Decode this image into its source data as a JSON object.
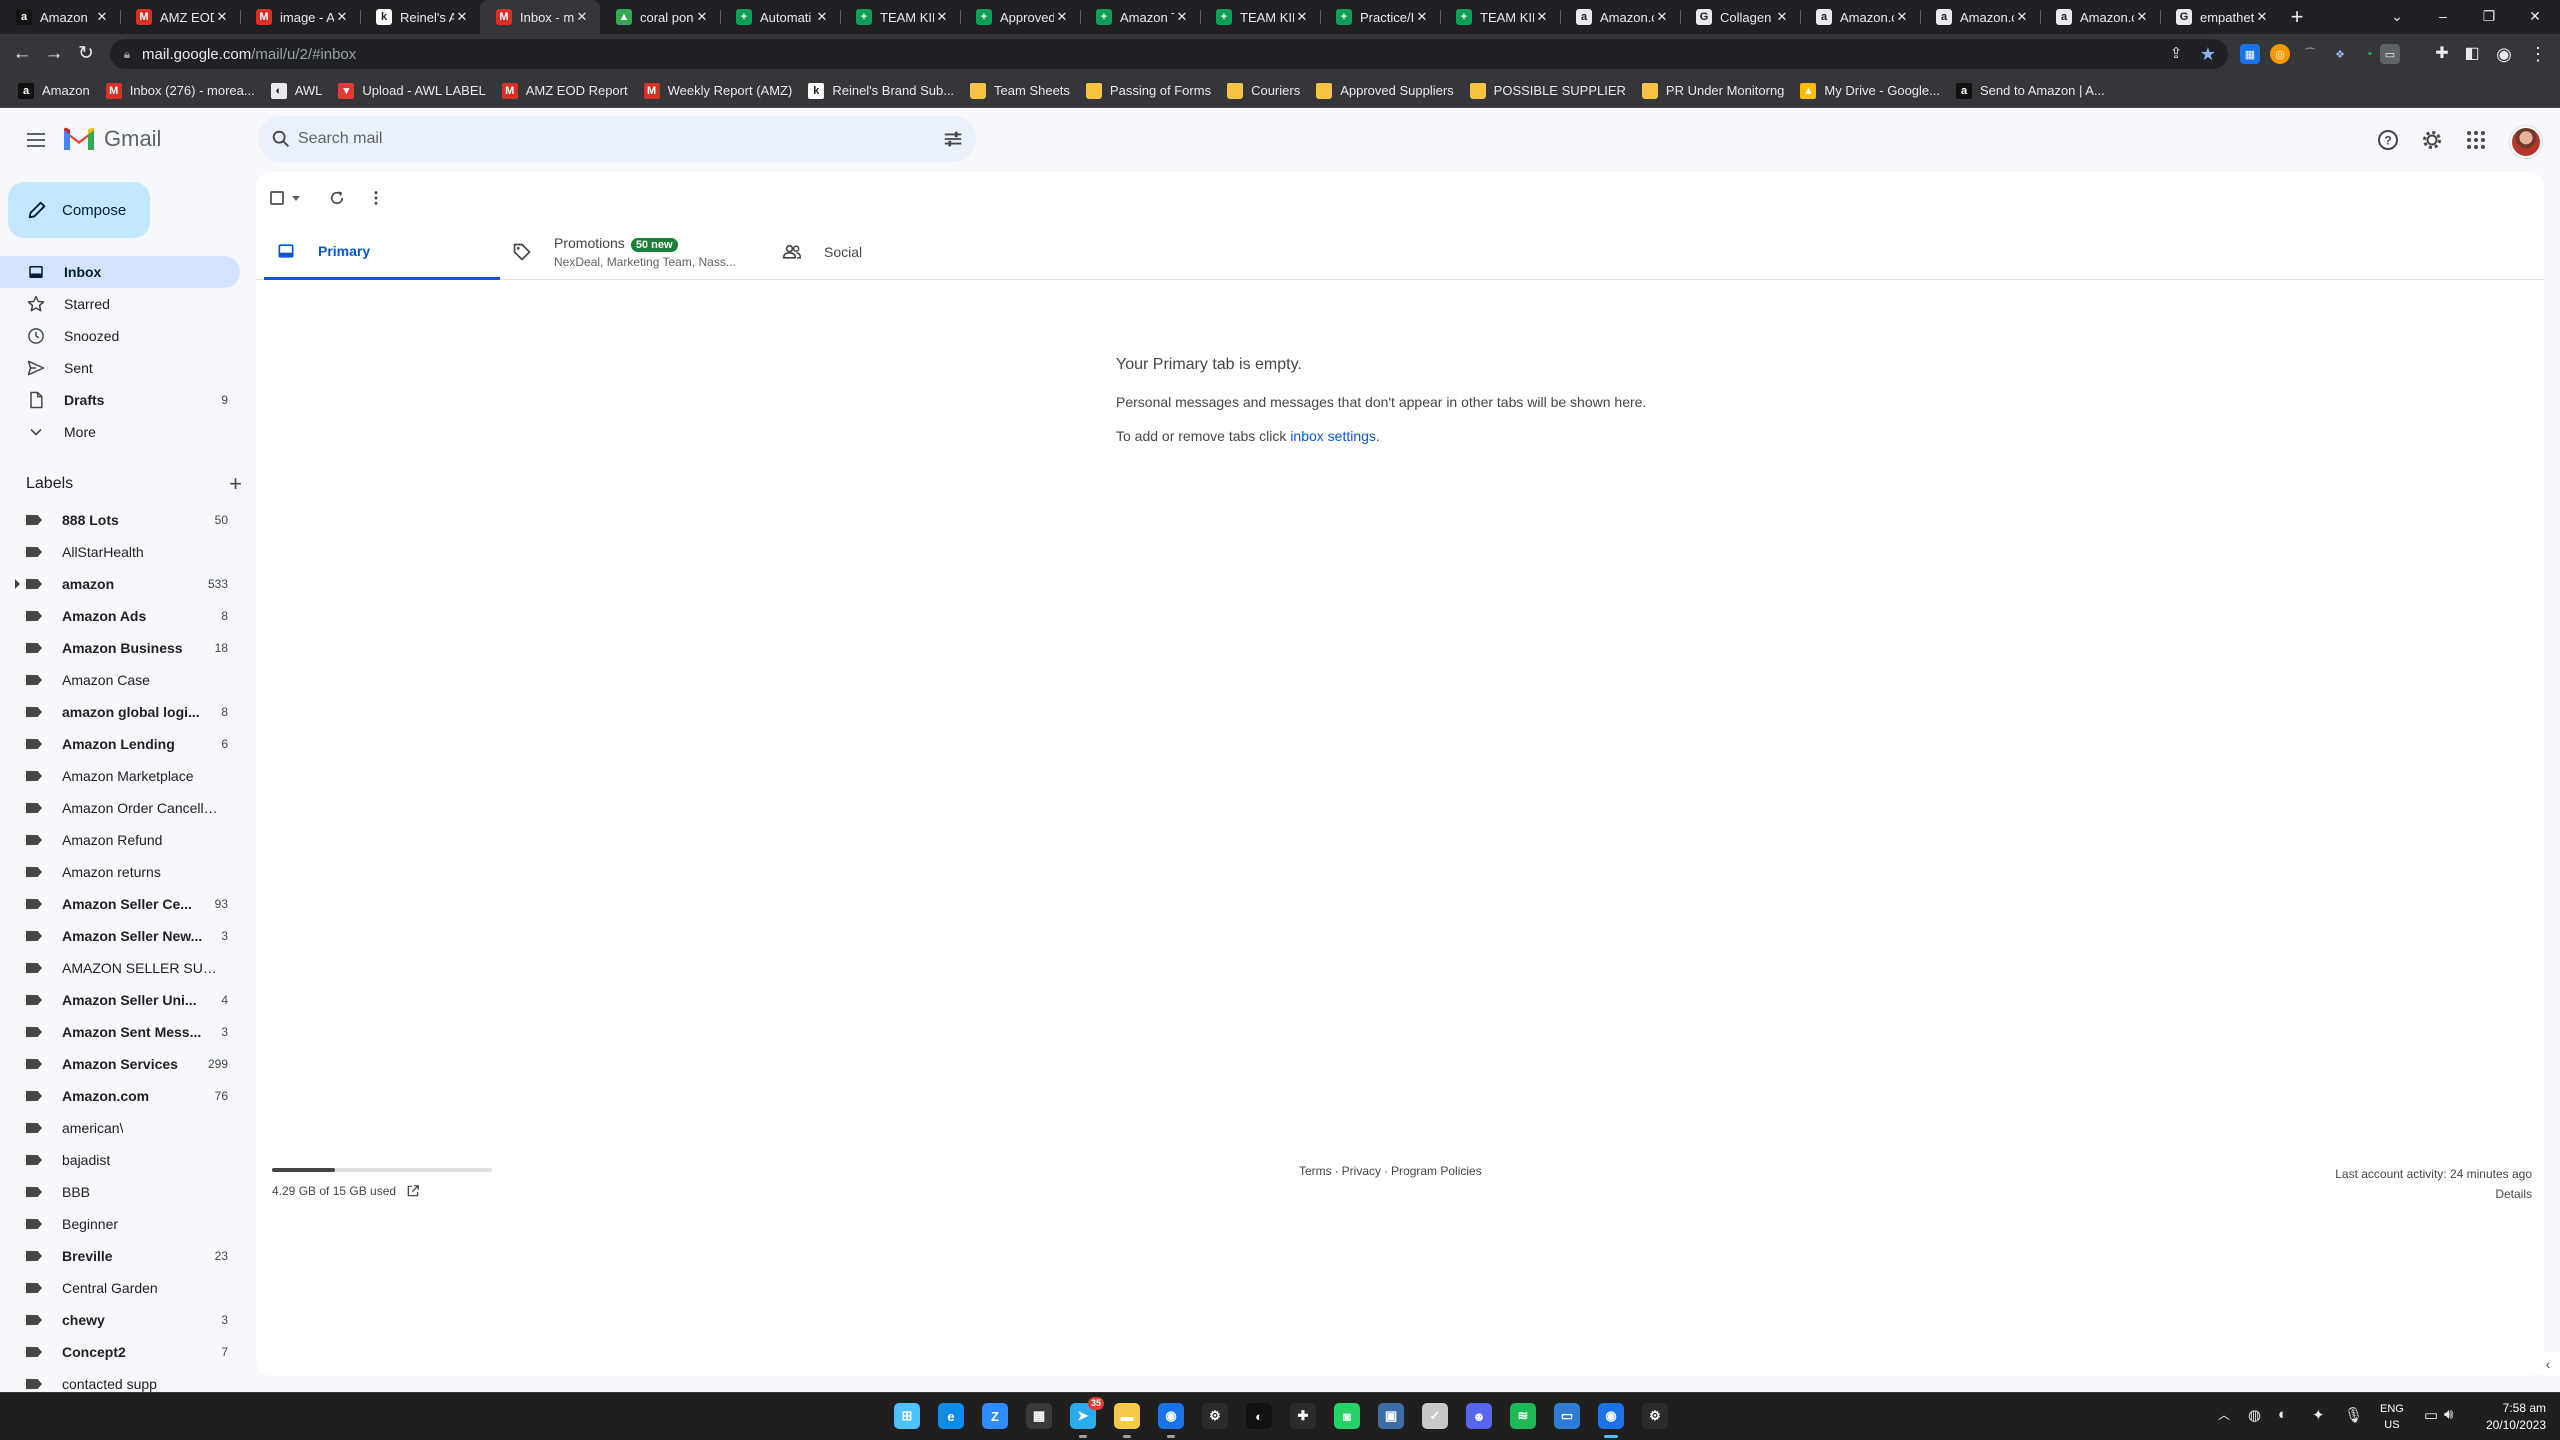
{
  "browser": {
    "tabs": [
      {
        "title": "Amazon",
        "icon": "amazon-icon",
        "color": "#111111",
        "glyph": "a"
      },
      {
        "title": "AMZ EOD",
        "icon": "gmail-icon",
        "color": "#d93025",
        "glyph": "M"
      },
      {
        "title": "image - A",
        "icon": "gmail-icon",
        "color": "#d93025",
        "glyph": "M"
      },
      {
        "title": "Reinel's A",
        "icon": "app-icon",
        "color": "#ffffff",
        "glyph": "k"
      },
      {
        "title": "Inbox - m",
        "icon": "gmail-icon",
        "color": "#d93025",
        "glyph": "M",
        "active": true
      },
      {
        "title": "coral pon",
        "icon": "drive-icon",
        "color": "#34a853",
        "glyph": "▲"
      },
      {
        "title": "Automati",
        "icon": "sheets-icon",
        "color": "#0f9d58",
        "glyph": "+"
      },
      {
        "title": "TEAM KIM",
        "icon": "sheets-icon",
        "color": "#0f9d58",
        "glyph": "+"
      },
      {
        "title": "Approved",
        "icon": "sheets-icon",
        "color": "#0f9d58",
        "glyph": "+"
      },
      {
        "title": "Amazon T",
        "icon": "sheets-icon",
        "color": "#0f9d58",
        "glyph": "+"
      },
      {
        "title": "TEAM KIM",
        "icon": "sheets-icon",
        "color": "#0f9d58",
        "glyph": "+"
      },
      {
        "title": "Practice/I",
        "icon": "sheets-icon",
        "color": "#0f9d58",
        "glyph": "+"
      },
      {
        "title": "TEAM KIM",
        "icon": "sheets-icon",
        "color": "#0f9d58",
        "glyph": "+"
      },
      {
        "title": "Amazon.c",
        "icon": "amazon-icon",
        "color": "#e8eaed",
        "glyph": "a"
      },
      {
        "title": "Collagen",
        "icon": "google-icon",
        "color": "#e8eaed",
        "glyph": "G"
      },
      {
        "title": "Amazon.c",
        "icon": "amazon-icon",
        "color": "#e8eaed",
        "glyph": "a"
      },
      {
        "title": "Amazon.c",
        "icon": "amazon-icon",
        "color": "#e8eaed",
        "glyph": "a"
      },
      {
        "title": "Amazon.c",
        "icon": "amazon-icon",
        "color": "#e8eaed",
        "glyph": "a"
      },
      {
        "title": "empathet",
        "icon": "google-icon",
        "color": "#e8eaed",
        "glyph": "G"
      }
    ],
    "url_host": "mail.google.com",
    "url_path": "/mail/u/2/#inbox",
    "bookmarks": [
      {
        "label": "Amazon",
        "icon": "amazon-icon",
        "kind": "site",
        "color": "#111111",
        "glyph": "a"
      },
      {
        "label": "Inbox (276) - morea...",
        "icon": "gmail-icon",
        "kind": "site",
        "color": "#d93025",
        "glyph": "M"
      },
      {
        "label": "AWL",
        "icon": "site-icon",
        "kind": "site",
        "color": "#e8eaed",
        "glyph": "◐"
      },
      {
        "label": "Upload - AWL LABEL",
        "icon": "site-icon",
        "kind": "site",
        "color": "#e53935",
        "glyph": "▾"
      },
      {
        "label": "AMZ EOD Report",
        "icon": "gmail-icon",
        "kind": "site",
        "color": "#d93025",
        "glyph": "M"
      },
      {
        "label": "Weekly Report (AMZ)",
        "icon": "gmail-icon",
        "kind": "site",
        "color": "#d93025",
        "glyph": "M"
      },
      {
        "label": "Reinel's Brand Sub...",
        "icon": "app-icon",
        "kind": "site",
        "color": "#ffffff",
        "glyph": "k"
      },
      {
        "label": "Team Sheets",
        "icon": "folder-icon",
        "kind": "folder"
      },
      {
        "label": "Passing of Forms",
        "icon": "folder-icon",
        "kind": "folder"
      },
      {
        "label": "Couriers",
        "icon": "folder-icon",
        "kind": "folder"
      },
      {
        "label": "Approved Suppliers",
        "icon": "folder-icon",
        "kind": "folder"
      },
      {
        "label": "POSSIBLE SUPPLIER",
        "icon": "folder-icon",
        "kind": "folder"
      },
      {
        "label": "PR Under Monitorng",
        "icon": "folder-icon",
        "kind": "folder"
      },
      {
        "label": "My Drive - Google...",
        "icon": "drive-icon",
        "kind": "site",
        "color": "#fbbc04",
        "glyph": "▲"
      },
      {
        "label": "Send to Amazon | A...",
        "icon": "amazon-icon",
        "kind": "site",
        "color": "#111111",
        "glyph": "a"
      }
    ]
  },
  "gmail": {
    "brand": "Gmail",
    "search_placeholder": "Search mail",
    "compose_label": "Compose",
    "nav": [
      {
        "label": "Inbox",
        "icon": "inbox-icon",
        "count": "",
        "active": true
      },
      {
        "label": "Starred",
        "icon": "star-icon",
        "count": ""
      },
      {
        "label": "Snoozed",
        "icon": "clock-icon",
        "count": ""
      },
      {
        "label": "Sent",
        "icon": "send-icon",
        "count": ""
      },
      {
        "label": "Drafts",
        "icon": "draft-icon",
        "count": "9",
        "bold": true
      },
      {
        "label": "More",
        "icon": "chevron-down-icon",
        "count": ""
      }
    ],
    "labels_title": "Labels",
    "labels": [
      {
        "name": "888 Lots",
        "count": "50",
        "bold": true
      },
      {
        "name": "AllStarHealth",
        "count": ""
      },
      {
        "name": "amazon",
        "count": "533",
        "bold": true,
        "expand": true
      },
      {
        "name": "Amazon Ads",
        "count": "8",
        "bold": true
      },
      {
        "name": "Amazon Business",
        "count": "18",
        "bold": true
      },
      {
        "name": "Amazon Case",
        "count": ""
      },
      {
        "name": "amazon global logi...",
        "count": "8",
        "bold": true
      },
      {
        "name": "Amazon Lending",
        "count": "6",
        "bold": true
      },
      {
        "name": "Amazon Marketplace",
        "count": ""
      },
      {
        "name": "Amazon Order Cancella...",
        "count": ""
      },
      {
        "name": "Amazon Refund",
        "count": ""
      },
      {
        "name": "Amazon returns",
        "count": ""
      },
      {
        "name": "Amazon Seller Ce...",
        "count": "93",
        "bold": true
      },
      {
        "name": "Amazon Seller New...",
        "count": "3",
        "bold": true
      },
      {
        "name": "AMAZON SELLER SUPP...",
        "count": ""
      },
      {
        "name": "Amazon Seller Uni...",
        "count": "4",
        "bold": true
      },
      {
        "name": "Amazon Sent Mess...",
        "count": "3",
        "bold": true
      },
      {
        "name": "Amazon Services",
        "count": "299",
        "bold": true
      },
      {
        "name": "Amazon.com",
        "count": "76",
        "bold": true
      },
      {
        "name": "american\\",
        "count": ""
      },
      {
        "name": "bajadist",
        "count": ""
      },
      {
        "name": "BBB",
        "count": ""
      },
      {
        "name": "Beginner",
        "count": ""
      },
      {
        "name": "Breville",
        "count": "23",
        "bold": true
      },
      {
        "name": "Central Garden",
        "count": ""
      },
      {
        "name": "chewy",
        "count": "3",
        "bold": true
      },
      {
        "name": "Concept2",
        "count": "7",
        "bold": true
      },
      {
        "name": "contacted supp",
        "count": ""
      }
    ],
    "inbox_tabs": [
      {
        "label": "Primary",
        "icon": "inbox-icon",
        "active": true
      },
      {
        "label": "Promotions",
        "icon": "tag-icon",
        "badge": "50 new",
        "subtitle": "NexDeal, Marketing Team, Nass..."
      },
      {
        "label": "Social",
        "icon": "people-icon"
      }
    ],
    "empty_title": "Your Primary tab is empty.",
    "empty_body": "Personal messages and messages that don't appear in other tabs will be shown here.",
    "empty_hint_prefix": "To add or remove tabs click ",
    "empty_hint_link": "inbox settings",
    "empty_hint_suffix": ".",
    "storage_text": "4.29 GB of 15 GB used",
    "storage_fraction": 0.286,
    "footer_terms": "Terms",
    "footer_privacy": "Privacy",
    "footer_policies": "Program Policies",
    "footer_sep": "·",
    "last_activity": "Last account activity: 24 minutes ago",
    "details_link": "Details"
  },
  "taskbar": {
    "apps": [
      "windows-start-icon",
      "edge-icon",
      "zoom-icon",
      "calculator-icon",
      "telegram-icon",
      "file-explorer-icon",
      "chrome-icon",
      "settings-icon",
      "app-icon",
      "xbox-icon",
      "whatsapp-icon",
      "virtualbox-icon",
      "tasks-icon",
      "discord-icon",
      "spotify-icon",
      "remote-desktop-icon",
      "chrome-icon",
      "settings-icon"
    ],
    "telegram_badge": "35",
    "lang_line1": "ENG",
    "lang_line2": "US",
    "time": "7:58 am",
    "date": "20/10/2023"
  },
  "colors": {
    "accent": "#0b57d0",
    "compose_bg": "#c2e7ff",
    "active_nav": "#d3e3fd",
    "promo_badge": "#188038"
  }
}
